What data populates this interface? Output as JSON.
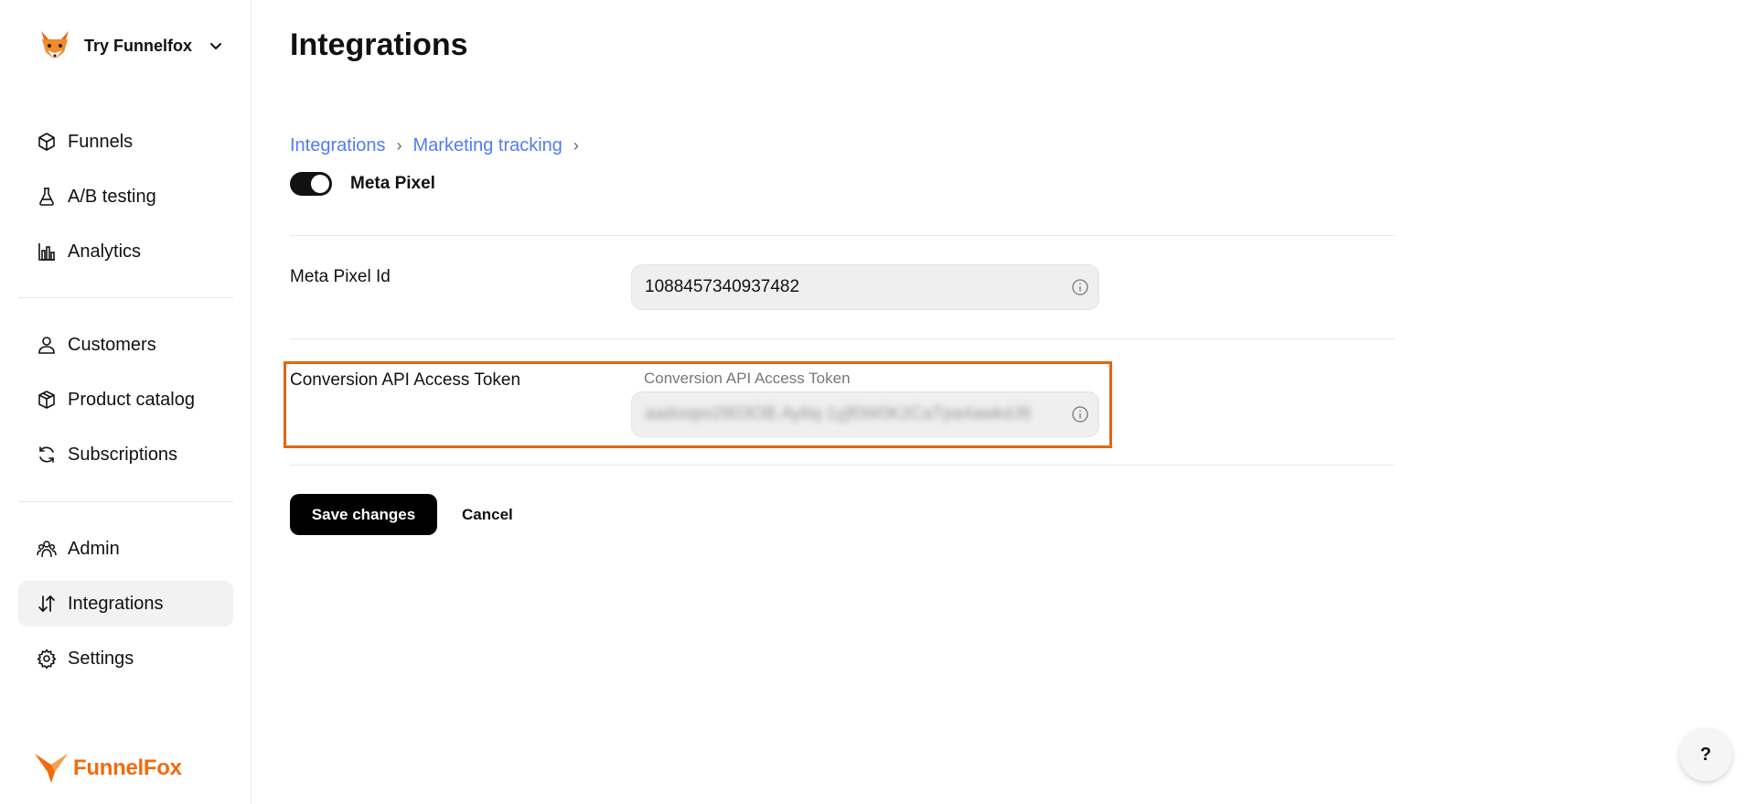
{
  "workspace": {
    "name": "Try Funnelfox"
  },
  "nav": {
    "group1": [
      {
        "label": "Funnels",
        "icon": "cube-icon"
      },
      {
        "label": "A/B testing",
        "icon": "flask-icon"
      },
      {
        "label": "Analytics",
        "icon": "bar-chart-icon"
      }
    ],
    "group2": [
      {
        "label": "Customers",
        "icon": "user-icon"
      },
      {
        "label": "Product catalog",
        "icon": "box-icon"
      },
      {
        "label": "Subscriptions",
        "icon": "refresh-icon"
      }
    ],
    "group3": [
      {
        "label": "Admin",
        "icon": "admin-users-icon"
      },
      {
        "label": "Integrations",
        "icon": "arrows-updown-icon",
        "active": true
      },
      {
        "label": "Settings",
        "icon": "gear-icon"
      }
    ]
  },
  "brand": {
    "name": "FunnelFox",
    "color": "#f26b0f"
  },
  "page": {
    "title": "Integrations",
    "breadcrumb": [
      "Integrations",
      "Marketing tracking"
    ],
    "integration_name": "Meta Pixel",
    "integration_enabled": true
  },
  "fields": {
    "pixel_id": {
      "label": "Meta Pixel Id",
      "value": "1088457340937482"
    },
    "access_token": {
      "label": "Conversion API Access Token",
      "floating_label": "Conversion API Access Token",
      "value": "aadoopo2903OB.Ay8q-1yjf0W0K2CaTpa4awkdJ6"
    }
  },
  "actions": {
    "save": "Save changes",
    "cancel": "Cancel"
  },
  "help": {
    "label": "?"
  },
  "colors": {
    "accent_link": "#4f7cf0",
    "highlight": "#e8640e"
  }
}
